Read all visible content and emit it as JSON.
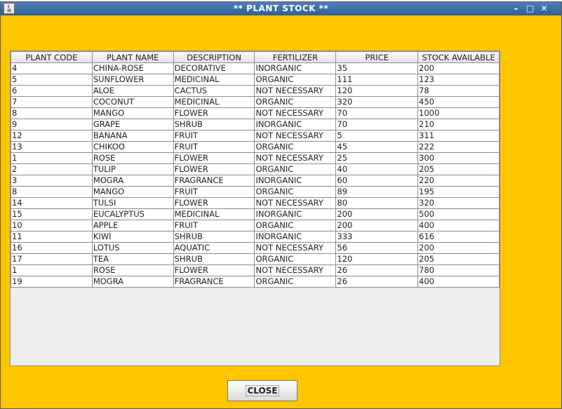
{
  "window": {
    "title": "**  PLANT STOCK  **",
    "controls": {
      "minimize": "–",
      "maximize": "□",
      "close": "✕"
    }
  },
  "table": {
    "columns": [
      "PLANT CODE",
      "PLANT NAME",
      "DESCRIPTION",
      "FERTILIZER",
      "PRICE",
      "STOCK AVAILABLE"
    ],
    "rows": [
      [
        "4",
        "CHINA-ROSE",
        "DECORATIVE",
        "INORGANIC",
        "35",
        "200"
      ],
      [
        "5",
        "SUNFLOWER",
        "MEDICINAL",
        "ORGANIC",
        "111",
        "123"
      ],
      [
        "6",
        "ALOE",
        "CACTUS",
        "NOT NECESSARY",
        "120",
        "78"
      ],
      [
        "7",
        "COCONUT",
        "MEDICINAL",
        "ORGANIC",
        "320",
        "450"
      ],
      [
        "8",
        "MANGO",
        "FLOWER",
        "NOT NECESSARY",
        "70",
        "1000"
      ],
      [
        "9",
        "GRAPE",
        "SHRUB",
        "INORGANIC",
        "70",
        "210"
      ],
      [
        "12",
        "BANANA",
        "FRUIT",
        "NOT NECESSARY",
        "5",
        "311"
      ],
      [
        "13",
        "CHIKOO",
        "FRUIT",
        "ORGANIC",
        "45",
        "222"
      ],
      [
        "1",
        "ROSE",
        "FLOWER",
        "NOT NECESSARY",
        "25",
        "300"
      ],
      [
        "2",
        "TULIP",
        "FLOWER",
        "ORGANIC",
        "40",
        "205"
      ],
      [
        "3",
        "MOGRA",
        "FRAGRANCE",
        "INORGANIC",
        "60",
        "220"
      ],
      [
        "8",
        "MANGO",
        "FRUIT",
        "ORGANIC",
        "89",
        "195"
      ],
      [
        "14",
        "TULSI",
        "FLOWER",
        "NOT NECESSARY",
        "80",
        "320"
      ],
      [
        "15",
        "EUCALYPTUS",
        "MEDICINAL",
        "INORGANIC",
        "200",
        "500"
      ],
      [
        "10",
        "APPLE",
        "FRUIT",
        "ORGANIC",
        "200",
        "400"
      ],
      [
        "11",
        "KIWI",
        "SHRUB",
        "INORGANIC",
        "333",
        "616"
      ],
      [
        "16",
        "LOTUS",
        "AQUATIC",
        "NOT NECESSARY",
        "56",
        "200"
      ],
      [
        "17",
        "TEA",
        "SHRUB",
        "ORGANIC",
        "120",
        "205"
      ],
      [
        "1",
        "ROSE",
        "FLOWER",
        "NOT NECESSARY",
        "26",
        "780"
      ],
      [
        "19",
        "MOGRA",
        "FRAGRANCE",
        "ORGANIC",
        "26",
        "400"
      ]
    ]
  },
  "buttons": {
    "close_label": "CLOSE"
  },
  "colors": {
    "window_background": "#ffc600",
    "titlebar": "#3a6aa8",
    "table_empty_area": "#eeeeee"
  }
}
